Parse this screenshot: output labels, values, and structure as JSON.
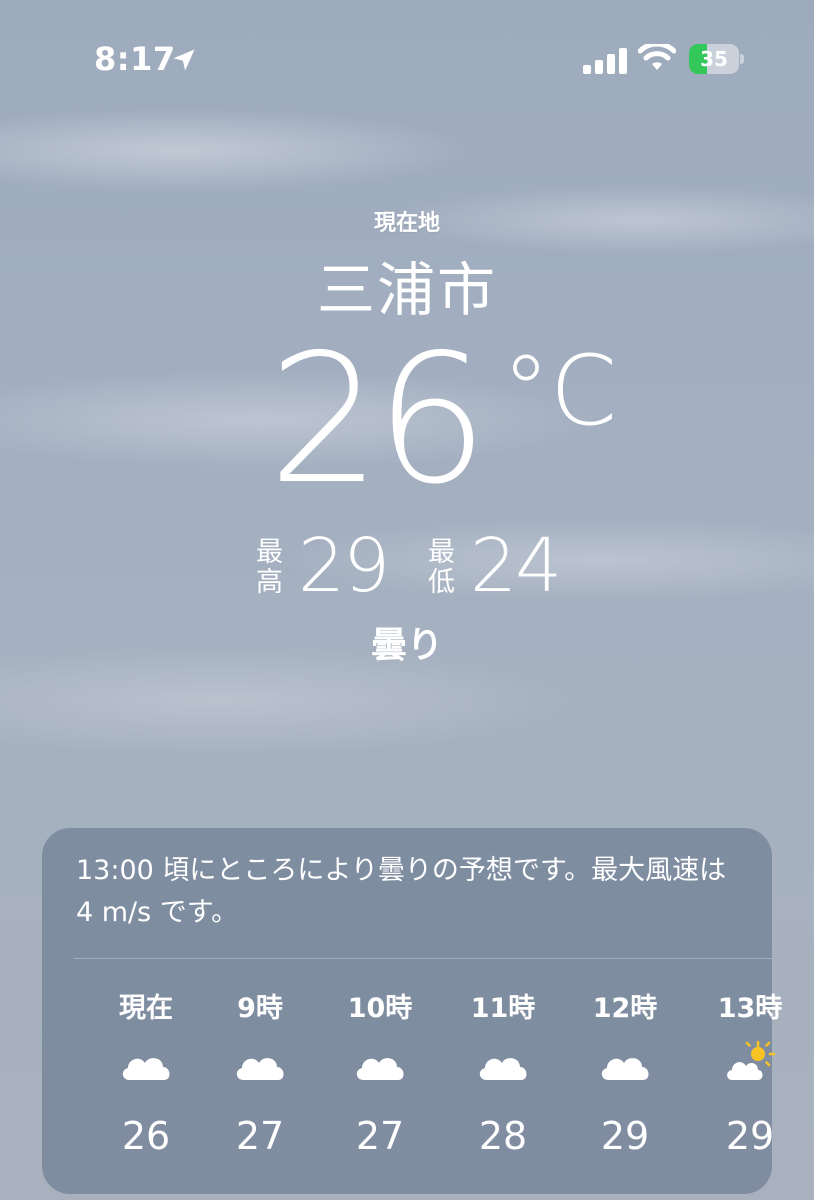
{
  "status_bar": {
    "time": "8:17",
    "battery": "35",
    "battery_level": 0.35,
    "battery_color": "#34c759"
  },
  "location": {
    "label": "現在地",
    "city": "三浦市"
  },
  "current": {
    "temperature": "26",
    "unit": "°C",
    "condition": "曇り"
  },
  "high_low": {
    "high_label": "最高",
    "high": "29",
    "low_label": "最低",
    "low": "24"
  },
  "forecast_card": {
    "summary": "13:00 頃にところにより曇りの予想です。最大風速は 4 m/s です。",
    "hours": [
      {
        "label": "現在",
        "icon": "cloud-icon",
        "temp": "26"
      },
      {
        "label": "9時",
        "icon": "cloud-icon",
        "temp": "27"
      },
      {
        "label": "10時",
        "icon": "cloud-icon",
        "temp": "27"
      },
      {
        "label": "11時",
        "icon": "cloud-icon",
        "temp": "28"
      },
      {
        "label": "12時",
        "icon": "cloud-icon",
        "temp": "29"
      },
      {
        "label": "13時",
        "icon": "partly-sunny-icon",
        "temp": "29"
      }
    ]
  },
  "colors": {
    "sun": "#f7c325",
    "card_bg": "#708096"
  }
}
